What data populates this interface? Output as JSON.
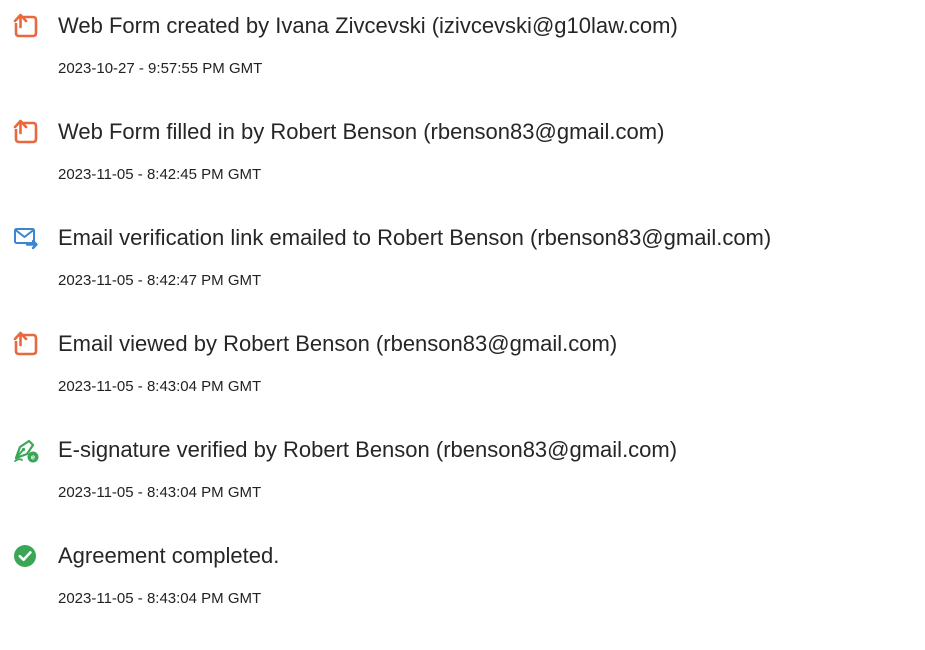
{
  "colors": {
    "accent_orange": "#e8683f",
    "accent_blue": "#3a86d1",
    "accent_green": "#3aa757",
    "text": "#262626"
  },
  "events": [
    {
      "icon": "document-upload-icon",
      "title": "Web Form created by Ivana Zivcevski (izivcevski@g10law.com)",
      "timestamp": "2023-10-27 - 9:57:55 PM GMT"
    },
    {
      "icon": "document-upload-icon",
      "title": "Web Form filled in by Robert Benson (rbenson83@gmail.com)",
      "timestamp": "2023-11-05 - 8:42:45 PM GMT"
    },
    {
      "icon": "email-send-icon",
      "title": "Email verification link emailed to Robert Benson (rbenson83@gmail.com)",
      "timestamp": "2023-11-05 - 8:42:47 PM GMT"
    },
    {
      "icon": "document-upload-icon",
      "title": "Email viewed by Robert Benson (rbenson83@gmail.com)",
      "timestamp": "2023-11-05 - 8:43:04 PM GMT"
    },
    {
      "icon": "e-signature-pen-icon",
      "title": "E-signature verified by Robert Benson (rbenson83@gmail.com)",
      "timestamp": "2023-11-05 - 8:43:04 PM GMT"
    },
    {
      "icon": "check-circle-icon",
      "title": "Agreement completed.",
      "timestamp": "2023-11-05 - 8:43:04 PM GMT"
    }
  ]
}
